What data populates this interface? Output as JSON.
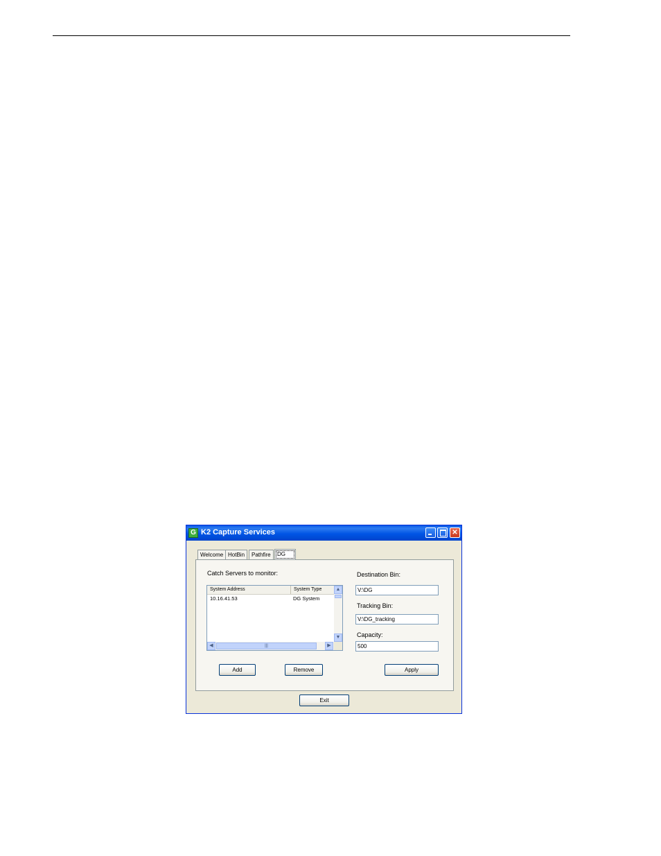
{
  "window": {
    "title": "K2 Capture Services",
    "icon": "k2-app-icon",
    "icon_glyph": "G",
    "controls": {
      "minimize_label": "_",
      "maximize_label": "□",
      "close_label": "✕"
    }
  },
  "tabs": [
    {
      "label": "Welcome",
      "active": false
    },
    {
      "label": "HotBin",
      "active": false
    },
    {
      "label": "Pathfire",
      "active": false
    },
    {
      "label": "DG",
      "active": true
    }
  ],
  "servers": {
    "heading": "Catch Servers to monitor:",
    "columns": [
      "System Address",
      "System Type"
    ],
    "rows": [
      {
        "address": "10.16.41.53",
        "type": "DG System"
      }
    ],
    "scroll": {
      "up": "▲",
      "down": "▼",
      "left": "◀",
      "right": "▶",
      "grip": "|||"
    }
  },
  "destination": {
    "label": "Destination Bin:",
    "value": "V:\\DG"
  },
  "tracking": {
    "label": "Tracking Bin:",
    "value": "V:\\DG_tracking"
  },
  "capacity": {
    "label": "Capacity:",
    "value": "500"
  },
  "buttons": {
    "add": "Add",
    "remove": "Remove",
    "apply": "Apply",
    "exit": "Exit"
  }
}
